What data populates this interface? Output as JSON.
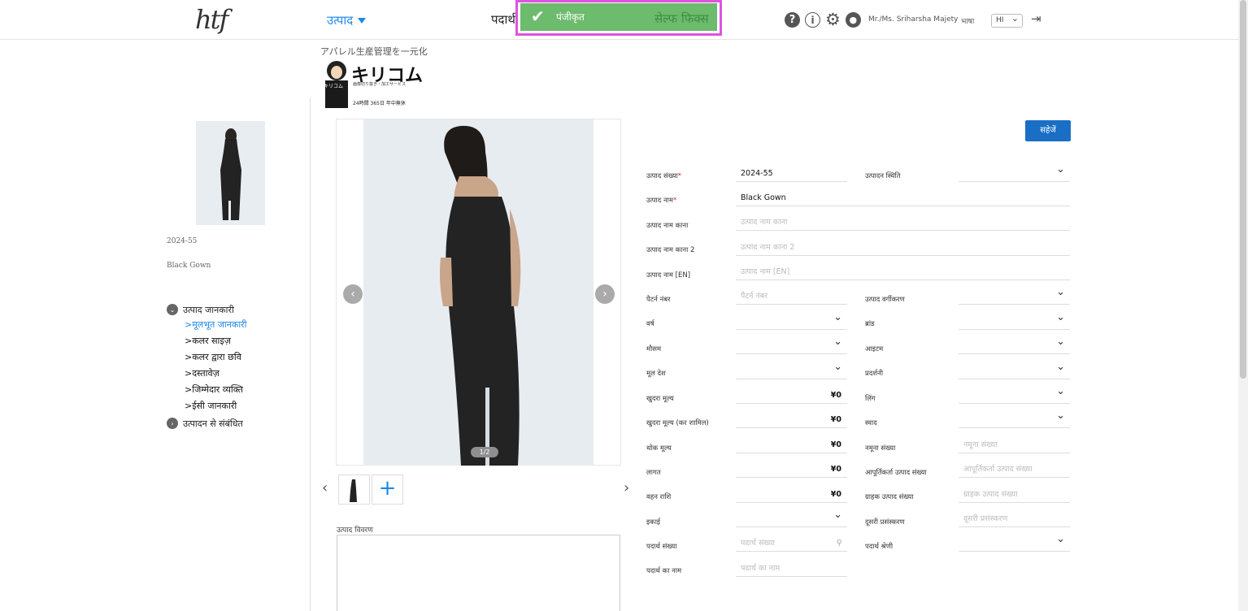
{
  "header": {
    "logo": "htf",
    "nav_product": "उत्पाद",
    "nav_material": "पदार्थ",
    "toast_message": "पंजीकृत",
    "toast_fix": "सेल्फ फिक्स",
    "help_icon": "help-icon",
    "info_icon": "info-icon",
    "settings_icon": "gear-icon",
    "user_name": "Mr./Ms. Sriharsha Majety",
    "language_label": "भाषा",
    "language_value": "HI"
  },
  "ad": {
    "tagline": "アパレル生産管理を一元化",
    "brand": "キリコム",
    "sub": "画像切り抜き・加工サービス",
    "hours": "24時間 365日 年中無休",
    "mascot_tag": "キリコム"
  },
  "sidebar": {
    "product_code": "2024-55",
    "product_name": "Black Gown",
    "group1": "उत्पाद जानकारी",
    "items": [
      "मूलभूत जानकारी",
      "कलर साइज़",
      "कलर द्वारा छवि",
      "दस्तावेज़",
      "जिम्मेदार व्यक्ति",
      "ईसी जानकारी"
    ],
    "group2": "उत्पादन से संबंधित"
  },
  "gallery": {
    "counter": "1/2",
    "add_symbol": "+",
    "description_label": "उत्पाद विवरण"
  },
  "form": {
    "save_label": "सहेजें",
    "product_number_label": "उत्पाद संख्या",
    "product_number_value": "2024-55",
    "production_status_label": "उत्पादन स्थिति",
    "product_name_label": "उत्पाद नाम",
    "product_name_value": "Black Gown",
    "product_name_kana_label": "उत्पाद नाम काना",
    "product_name_kana_placeholder": "उत्पाद नाम काना",
    "product_name_kana2_label": "उत्पाद नाम काना 2",
    "product_name_kana2_placeholder": "उत्पाद नाम काना 2",
    "product_name_en_label": "उत्पाद नाम [EN]",
    "product_name_en_placeholder": "उत्पाद नाम [EN]",
    "pattern_number_label": "पैटर्न नंबर",
    "pattern_number_placeholder": "पैटर्न नंबर",
    "product_classification_label": "उत्पाद वर्गीकरण",
    "year_label": "वर्ष",
    "brand_label": "ब्रांड",
    "season_label": "मौसम",
    "item_label": "आइटम",
    "origin_label": "मूल देश",
    "exhibition_label": "प्रदर्शनी",
    "retail_price_label": "खुदरा मूल्य",
    "retail_price_value": "¥0",
    "gender_label": "लिंग",
    "retail_price_tax_label": "खुदरा मूल्य (कर शामिल)",
    "retail_price_tax_value": "¥0",
    "taste_label": "स्वाद",
    "wholesale_price_label": "थोक मूल्य",
    "wholesale_price_value": "¥0",
    "sample_number_label": "नमूना संख्या",
    "sample_number_placeholder": "नमूना संख्या",
    "cost_label": "लागत",
    "cost_value": "¥0",
    "supplier_number_label": "आपूर्तिकर्ता उत्पाद संख्या",
    "supplier_number_placeholder": "आपूर्तिकर्ता उत्पाद संख्या",
    "carrying_amount_label": "वहन राशि",
    "carrying_amount_value": "¥0",
    "customer_number_label": "ग्राहक उत्पाद संख्या",
    "customer_number_placeholder": "ग्राहक उत्पाद संख्या",
    "unit_label": "इकाई",
    "secondary_processing_label": "दूसरी प्रसंस्करण",
    "secondary_processing_placeholder": "दूसरी प्रसंस्करण",
    "material_number_label": "पदार्थ संख्या",
    "material_number_placeholder": "पदार्थ संख्या",
    "material_category_label": "पदार्थ श्रेणी",
    "material_name_label": "पदार्थ का नाम",
    "material_name_placeholder": "पदार्थ का नाम"
  },
  "colors": {
    "accent": "#1e88e5",
    "save_button": "#1a6fc4",
    "toast": "#6dbb6d",
    "highlight": "#e052e0"
  }
}
